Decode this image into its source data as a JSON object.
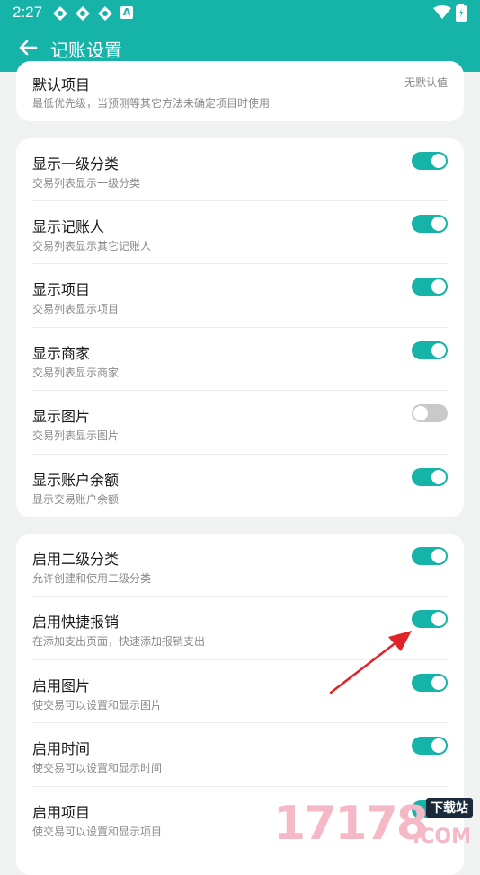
{
  "status": {
    "time": "2:27",
    "letter_badge": "A"
  },
  "appbar": {
    "title": "记账设置"
  },
  "default_project": {
    "title": "默认项目",
    "subtitle": "最低优先级，当预测等其它方法未确定项目时使用",
    "value": "无默认值"
  },
  "display_settings": [
    {
      "title": "显示一级分类",
      "subtitle": "交易列表显示一级分类",
      "enabled": true
    },
    {
      "title": "显示记账人",
      "subtitle": "交易列表显示其它记账人",
      "enabled": true
    },
    {
      "title": "显示项目",
      "subtitle": "交易列表显示项目",
      "enabled": true
    },
    {
      "title": "显示商家",
      "subtitle": "交易列表显示商家",
      "enabled": true
    },
    {
      "title": "显示图片",
      "subtitle": "交易列表显示图片",
      "enabled": false
    },
    {
      "title": "显示账户余额",
      "subtitle": "显示交易账户余额",
      "enabled": true
    }
  ],
  "feature_settings": [
    {
      "title": "启用二级分类",
      "subtitle": "允许创建和使用二级分类",
      "enabled": true
    },
    {
      "title": "启用快捷报销",
      "subtitle": "在添加支出页面，快速添加报销支出",
      "enabled": true
    },
    {
      "title": "启用图片",
      "subtitle": "使交易可以设置和显示图片",
      "enabled": true
    },
    {
      "title": "启用时间",
      "subtitle": "使交易可以设置和显示时间",
      "enabled": true
    },
    {
      "title": "启用项目",
      "subtitle": "使交易可以设置和显示项目",
      "enabled": true
    }
  ],
  "watermark": {
    "brand": "17178",
    "domain": ".COM",
    "tag": "下载站"
  },
  "colors": {
    "accent": "#15b3a8",
    "arrow": "#e0222a",
    "background": "#f0f2f1"
  }
}
